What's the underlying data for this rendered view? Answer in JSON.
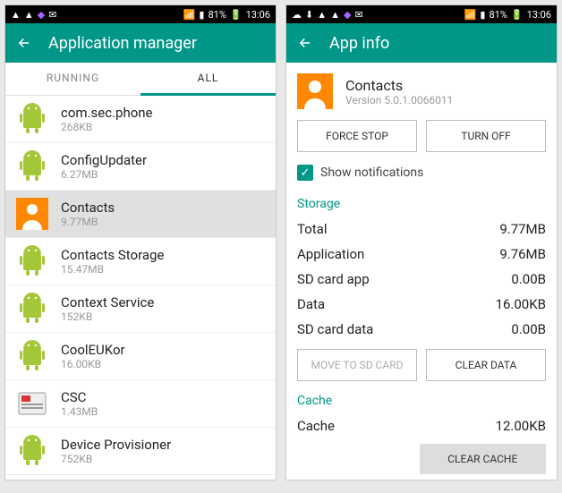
{
  "status": {
    "battery": "81%",
    "time": "13:06"
  },
  "left": {
    "title": "Application manager",
    "tabs": [
      "RUNNING",
      "ALL"
    ],
    "activeTab": 1,
    "apps": [
      {
        "name": "com.sec.phone",
        "size": "268KB",
        "icon": "android"
      },
      {
        "name": "ConfigUpdater",
        "size": "6.27MB",
        "icon": "android"
      },
      {
        "name": "Contacts",
        "size": "9.77MB",
        "icon": "contacts",
        "selected": true
      },
      {
        "name": "Contacts Storage",
        "size": "15.47MB",
        "icon": "android"
      },
      {
        "name": "Context Service",
        "size": "152KB",
        "icon": "android"
      },
      {
        "name": "CoolEUKor",
        "size": "16.00KB",
        "icon": "android"
      },
      {
        "name": "CSC",
        "size": "1.43MB",
        "icon": "csc"
      },
      {
        "name": "Device Provisioner",
        "size": "752KB",
        "icon": "android"
      }
    ]
  },
  "right": {
    "title": "App info",
    "app": {
      "name": "Contacts",
      "version": "Version 5.0.1.0066011"
    },
    "buttons": {
      "forceStop": "FORCE STOP",
      "turnOff": "TURN OFF",
      "moveSd": "MOVE TO SD CARD",
      "clearData": "CLEAR DATA",
      "clearCache": "CLEAR CACHE"
    },
    "showNotifications": "Show notifications",
    "sections": {
      "storage": "Storage",
      "cache": "Cache"
    },
    "storage": [
      {
        "k": "Total",
        "v": "9.77MB"
      },
      {
        "k": "Application",
        "v": "9.76MB"
      },
      {
        "k": "SD card app",
        "v": "0.00B"
      },
      {
        "k": "Data",
        "v": "16.00KB"
      },
      {
        "k": "SD card data",
        "v": "0.00B"
      }
    ],
    "cache": {
      "k": "Cache",
      "v": "12.00KB"
    }
  }
}
